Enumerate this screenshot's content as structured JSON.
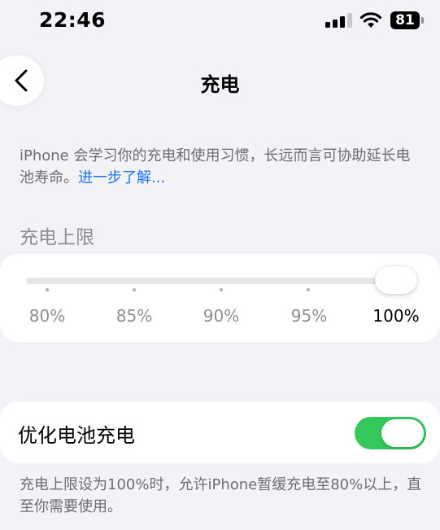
{
  "status_bar": {
    "time": "22:46",
    "battery_level": "81",
    "signal_icon": "cellular-signal-icon",
    "wifi_icon": "wifi-icon"
  },
  "nav": {
    "title": "充电",
    "back_icon": "chevron-left-icon"
  },
  "description": {
    "text": "iPhone 会学习你的充电和使用习惯，长远而言可协助延长电池寿命。",
    "link": "进一步了解..."
  },
  "charge_limit": {
    "header": "充电上限",
    "options": [
      "80%",
      "85%",
      "90%",
      "95%",
      "100%"
    ],
    "selected_index": 4,
    "selected_value": "100%"
  },
  "optimized_charging": {
    "label": "优化电池充电",
    "enabled": true,
    "note": "充电上限设为100%时，允许iPhone暂缓充电至80%以上，直至你需要使用。"
  },
  "colors": {
    "accent_green": "#34c759",
    "link_blue": "#1a73e8",
    "background": "#f2f2f7"
  }
}
